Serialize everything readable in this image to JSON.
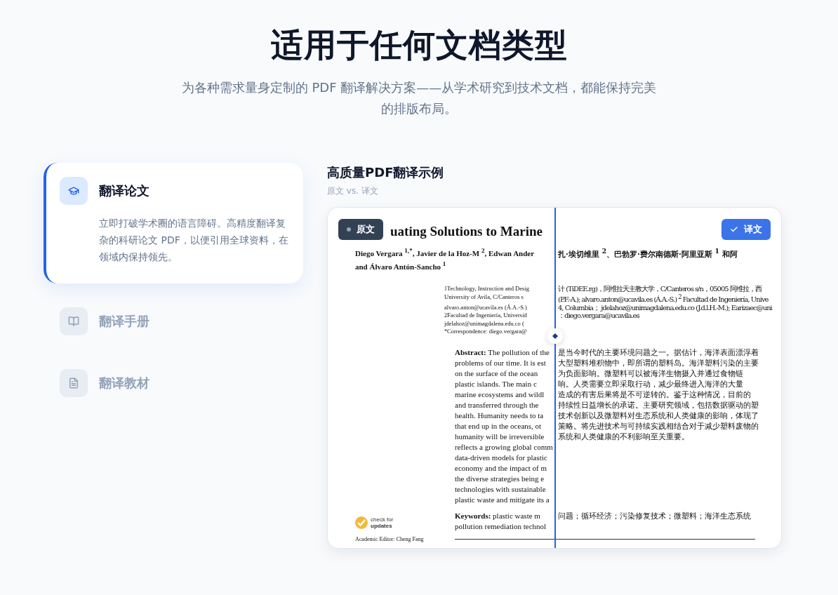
{
  "header": {
    "title": "适用于任何文档类型",
    "subtitle": "为各种需求量身定制的 PDF 翻译解决方案——从学术研究到技术文档，都能保持完美的排版布局。"
  },
  "tabs": [
    {
      "kind": "paper",
      "title": "翻译论文",
      "selected": true,
      "description": "立即打破学术圈的语言障碍。高精度翻译复杂的科研论文 PDF，以便引用全球资料，在领域内保持领先。"
    },
    {
      "kind": "manual",
      "title": "翻译手册",
      "selected": false
    },
    {
      "kind": "textbook",
      "title": "翻译教材",
      "selected": false
    }
  ],
  "preview": {
    "title": "高质量PDF翻译示例",
    "subtitle": "原文 vs. 译文",
    "original_badge": "原文",
    "translated_badge": "译文",
    "document": {
      "title": "uating Solutions to Marine",
      "authors": [
        {
          "left": "Diego Vergara $^{1,*}$, Javier de la Hoz-M $^{2}$, Edwan Ander",
          "right": "扎·埃切维里 $^{2}$、巴勃罗·费尔南德斯·阿里亚斯 $^{1}$ 和阿"
        },
        {
          "left": "and Álvaro Antón-Sancho $^{1}$"
        }
      ],
      "affiliations": [
        {
          "mark": "1",
          "left": "Technology, Instruction and Desig",
          "right": "计 (TiDEE.rg)，阿维拉天主教大学，C/Canteros s/n，05005 阿维拉，西"
        },
        {
          "left": "University of Avila, C/Canteros s",
          "right": "(P.F.-A.); alvaro.anton@ucavila.es (Á.A.-S.) $^{2}$ Facultad de Ingeniería, Unive"
        },
        {
          "left": "alvaro.anton@ucavila.es (Á.A.-S.)",
          "right": "4, Columbia； jdelahoz@unimagdalena.edu.co (J.d.l.H.-M.); Earizaec@uni"
        },
        {
          "mark": "2",
          "left": "Facultad de Ingeniería, Universid",
          "right": "：diego.vergara@ucavila.es"
        },
        {
          "left": "jdelahoz@unimagdalena.edu.co ("
        },
        {
          "mark": "*",
          "left": "Correspondence: diego.vergara@"
        }
      ],
      "abstract": [
        {
          "left": "**Abstract:** The pollution of the",
          "right": "是当今时代的主要环境问题之一。据估计，海洋表面漂浮着"
        },
        {
          "left": "problems of our time. It is est",
          "right": "大型塑料堆积物中，即所谓的塑料岛。海洋塑料污染的主要"
        },
        {
          "left": "on the surface of the ocean",
          "right": "为负面影响。微塑料可以被海洋生物摄入并通过食物链"
        },
        {
          "left": "plastic islands. The main c",
          "right": "响。人类需要立即采取行动，减少最终进入海洋的大量"
        },
        {
          "left": "marine ecosystems and wildl",
          "right": "造成的有害后果将是不可逆转的。鉴于这种情况，目前的"
        },
        {
          "left": "and transferred through the",
          "right": "持续性日益增长的承诺。主要研究领域，包括数据驱动的塑"
        },
        {
          "left": "health. Humanity needs to ta",
          "right": "技术创新以及微塑料对生态系统和人类健康的影响，体现了"
        },
        {
          "left": "that end up in the oceans, ot",
          "right": "策略。将先进技术与可持续实践相结合对于减少塑料废物的"
        },
        {
          "left": "humanity will be irreversible",
          "right": "系统和人类健康的不利影响至关重要。"
        },
        {
          "left": "reflects a growing global comm"
        },
        {
          "left": "data-driven models for plastic"
        },
        {
          "left": "economy and the impact of m"
        },
        {
          "left": "the diverse strategies being e"
        },
        {
          "left": "technologies with sustainable"
        },
        {
          "left": "plastic waste and mitigate its a"
        }
      ],
      "keywords": [
        {
          "left": "**Keywords:** plastic waste m",
          "right": "问题；循环经济；污染修复技术；微塑料；海洋生态系统"
        },
        {
          "left": "pollution remediation technol"
        }
      ],
      "check_updates": {
        "line1": "check for",
        "line2": "updates"
      },
      "editor": "Academic Editor: Cheng Fang"
    }
  }
}
